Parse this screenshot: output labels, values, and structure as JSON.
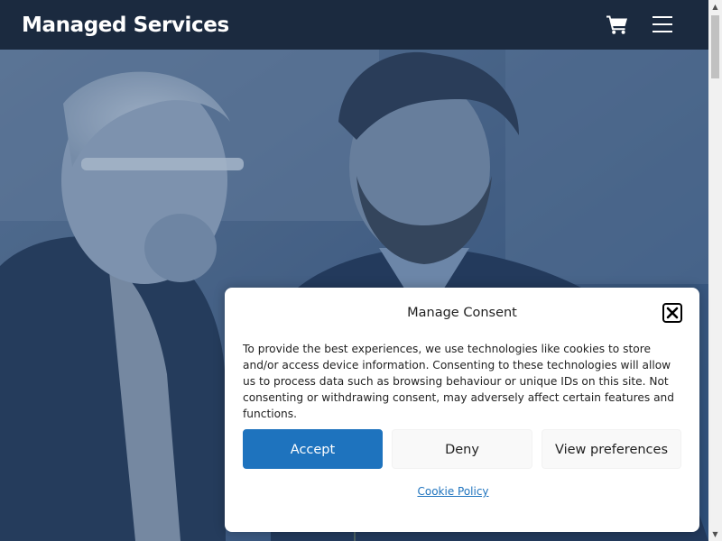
{
  "header": {
    "site_title": "Managed Services",
    "cart_icon": "shopping-cart-icon",
    "menu_icon": "hamburger-menu-icon"
  },
  "hero": {
    "overlay_color": "#2c4f7c"
  },
  "consent": {
    "title": "Manage Consent",
    "close_icon": "close-icon",
    "body": "To provide the best experiences, we use technologies like cookies to store and/or access device information. Consenting to these technologies will allow us to process data such as browsing behaviour or unique IDs on this site. Not consenting or withdrawing consent, may adversely affect certain features and functions.",
    "accept_label": "Accept",
    "deny_label": "Deny",
    "preferences_label": "View preferences",
    "cookie_policy_label": "Cookie Policy"
  },
  "colors": {
    "header_bg": "#1b2a3f",
    "accent": "#1e73be",
    "secondary_button_bg": "#f9f9f9"
  }
}
